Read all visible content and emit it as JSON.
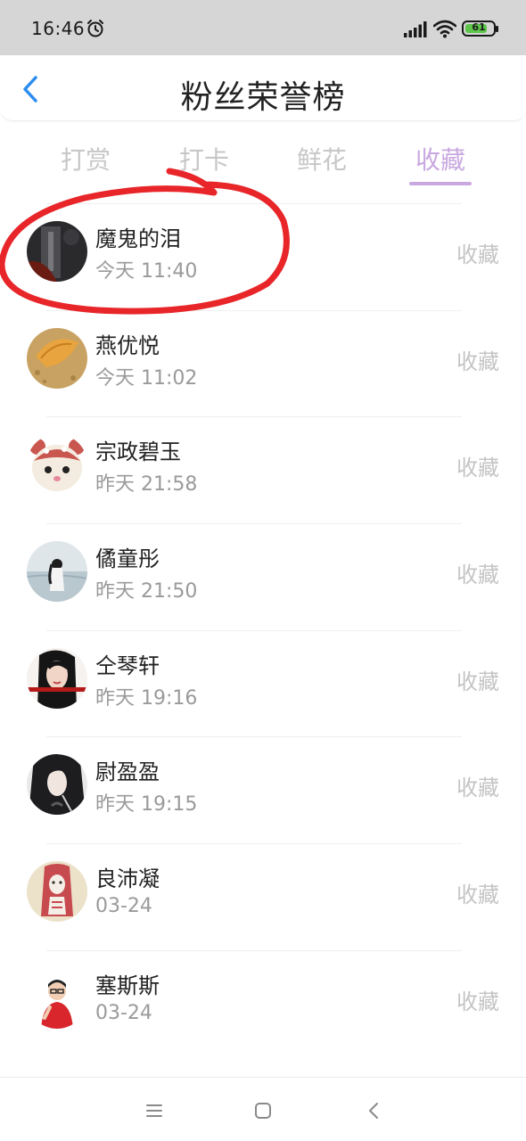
{
  "status_bar": {
    "time": "16:46",
    "battery_level": "61",
    "icons": [
      "alarm-icon",
      "signal-icon",
      "wifi-icon",
      "battery-icon"
    ],
    "battery_color": "#5ec44b"
  },
  "header": {
    "title": "粉丝荣誉榜",
    "back_icon": "chevron-left-icon",
    "back_color": "#2d8cf0"
  },
  "tabs": {
    "items": [
      {
        "label": "打赏",
        "active": false
      },
      {
        "label": "打卡",
        "active": false
      },
      {
        "label": "鲜花",
        "active": false
      },
      {
        "label": "收藏",
        "active": true
      }
    ],
    "active_color": "#c9a8e0",
    "inactive_color": "#c7c7c7"
  },
  "fans": [
    {
      "name": "魔鬼的泪",
      "time": "今天 11:40",
      "action": "收藏"
    },
    {
      "name": "燕优悦",
      "time": "今天 11:02",
      "action": "收藏"
    },
    {
      "name": "宗政碧玉",
      "time": "昨天 21:58",
      "action": "收藏"
    },
    {
      "name": "僪童彤",
      "time": "昨天 21:50",
      "action": "收藏"
    },
    {
      "name": "仝琴轩",
      "time": "昨天 19:16",
      "action": "收藏"
    },
    {
      "name": "尉盈盈",
      "time": "昨天 19:15",
      "action": "收藏"
    },
    {
      "name": "良沛凝",
      "time": "03-24",
      "action": "收藏"
    },
    {
      "name": "塞斯斯",
      "time": "03-24",
      "action": "收藏"
    }
  ],
  "annotation": {
    "color": "#e8262a"
  },
  "nav_bar": {
    "icons": [
      "menu-icon",
      "home-square-icon",
      "back-triangle-icon"
    ]
  }
}
